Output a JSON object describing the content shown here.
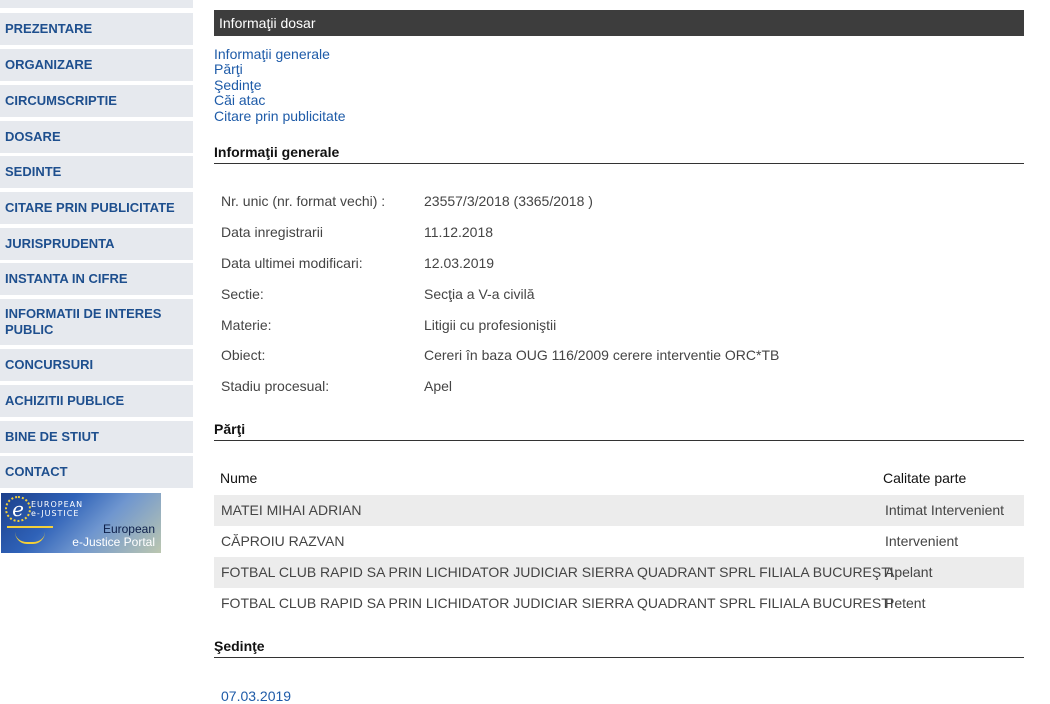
{
  "sidebar": {
    "items": [
      {
        "label": "PREZENTARE"
      },
      {
        "label": "ORGANIZARE"
      },
      {
        "label": "CIRCUMSCRIPTIE"
      },
      {
        "label": "DOSARE"
      },
      {
        "label": "SEDINTE"
      },
      {
        "label": "CITARE PRIN PUBLICITATE"
      },
      {
        "label": "JURISPRUDENTA"
      },
      {
        "label": "INSTANTA IN CIFRE"
      },
      {
        "label": "INFORMATII DE INTERES PUBLIC"
      },
      {
        "label": "CONCURSURI"
      },
      {
        "label": "ACHIZITII PUBLICE"
      },
      {
        "label": "BINE DE STIUT"
      },
      {
        "label": "CONTACT"
      }
    ],
    "banner": {
      "logo_text_top": "EUROPEAN e-JUSTICE",
      "logo_letter": "e",
      "line1": "European",
      "line2": "e-Justice Portal"
    }
  },
  "main": {
    "header": "Informaţii dosar",
    "toc": [
      "Informaţii generale",
      "Părţi",
      "Şedinţe",
      "Căi atac",
      "Citare prin publicitate"
    ],
    "general": {
      "title": "Informaţii generale",
      "rows": [
        {
          "label": "Nr. unic (nr. format vechi) :",
          "value": "23557/3/2018 (3365/2018 )"
        },
        {
          "label": "Data inregistrarii",
          "value": "11.12.2018"
        },
        {
          "label": "Data ultimei modificari:",
          "value": "12.03.2019"
        },
        {
          "label": "Sectie:",
          "value": "Secţia a V-a civilă"
        },
        {
          "label": "Materie:",
          "value": "Litigii cu profesioniştii"
        },
        {
          "label": "Obiect:",
          "value": "Cereri în baza OUG 116/2009 cerere interventie ORC*TB"
        },
        {
          "label": "Stadiu procesual:",
          "value": "Apel"
        }
      ]
    },
    "parti": {
      "title": "Părţi",
      "col_name": "Nume",
      "col_role": "Calitate parte",
      "rows": [
        {
          "name": "MATEI MIHAI ADRIAN",
          "role": "Intimat Intervenient"
        },
        {
          "name": "CĂPROIU RAZVAN",
          "role": "Intervenient"
        },
        {
          "name": "FOTBAL CLUB RAPID SA PRIN LICHIDATOR JUDICIAR SIERRA QUADRANT SPRL FILIALA BUCUREŞTI",
          "role": "Apelant"
        },
        {
          "name": "FOTBAL CLUB RAPID SA PRIN LICHIDATOR JUDICIAR SIERRA QUADRANT SPRL FILIALA BUCURESTI",
          "role": "Petent"
        }
      ]
    },
    "sedinte": {
      "title": "Şedinţe",
      "first_date": "07.03.2019"
    }
  }
}
